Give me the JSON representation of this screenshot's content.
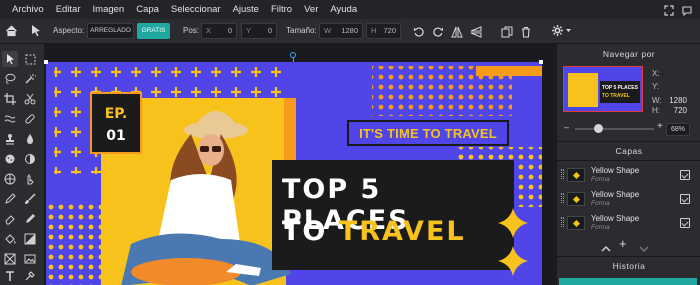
{
  "menu": {
    "items": [
      "Archivo",
      "Editar",
      "Imagen",
      "Capa",
      "Seleccionar",
      "Ajuste",
      "Filtro",
      "Ver",
      "Ayuda"
    ]
  },
  "options": {
    "aspect_label": "Aspecto:",
    "aspect_locked": "ARREGLADO",
    "aspect_free": "GRATIS",
    "pos_label": "Pos:",
    "pos_x_prefix": "X",
    "pos_x": "0",
    "pos_y_prefix": "Y",
    "pos_y": "0",
    "size_label": "Tamaño:",
    "size_w_prefix": "W",
    "size_w": "1280",
    "size_h_prefix": "H",
    "size_h": "720"
  },
  "canvas": {
    "ep_line1": "EP.",
    "ep_line2": "01",
    "tagline": "IT'S TIME TO TRAVEL",
    "headline_line1": "TOP 5 PLACES",
    "headline_line2_prefix": "TO ",
    "headline_line2_accent": "TRAVEL"
  },
  "navigator": {
    "title": "Navegar por",
    "x_label": "X:",
    "y_label": "Y:",
    "w_label": "W:",
    "w_value": "1280",
    "h_label": "H:",
    "h_value": "720",
    "zoom_minus": "–",
    "zoom_plus": "+",
    "zoom": "68%",
    "thumb_text1": "TOP 5 PLACES",
    "thumb_text2": "TO TRAVEL",
    "zoom_fraction": 0.3
  },
  "layers": {
    "title": "Capas",
    "items": [
      {
        "name": "Yellow Shape",
        "type": "Forma"
      },
      {
        "name": "Yellow Shape",
        "type": "Forma"
      },
      {
        "name": "Yellow Shape",
        "type": "Forma"
      }
    ],
    "add": "+"
  },
  "history": {
    "title": "Historia"
  },
  "colors": {
    "accent": "#1ea8a0",
    "canvas_purple": "#5046e8",
    "yellow": "#f7c21b",
    "orange": "#f59a1a"
  }
}
